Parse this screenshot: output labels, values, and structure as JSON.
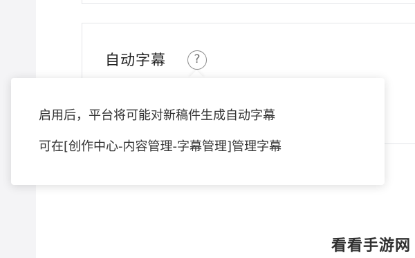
{
  "setting": {
    "title": "自动字幕",
    "help_icon": "question-circle-icon",
    "help_glyph": "?"
  },
  "tooltip": {
    "line1": "启用后，平台将可能对新稿件生成自动字幕",
    "line2": "可在[创作中心-内容管理-字幕管理]管理字幕"
  },
  "watermark": {
    "text": "看看手游网"
  },
  "colors": {
    "border": "#e3e5e8",
    "gutter": "#f4f4f6",
    "title_text": "#222222",
    "tooltip_text": "#333333",
    "icon": "#8a8a8a"
  }
}
